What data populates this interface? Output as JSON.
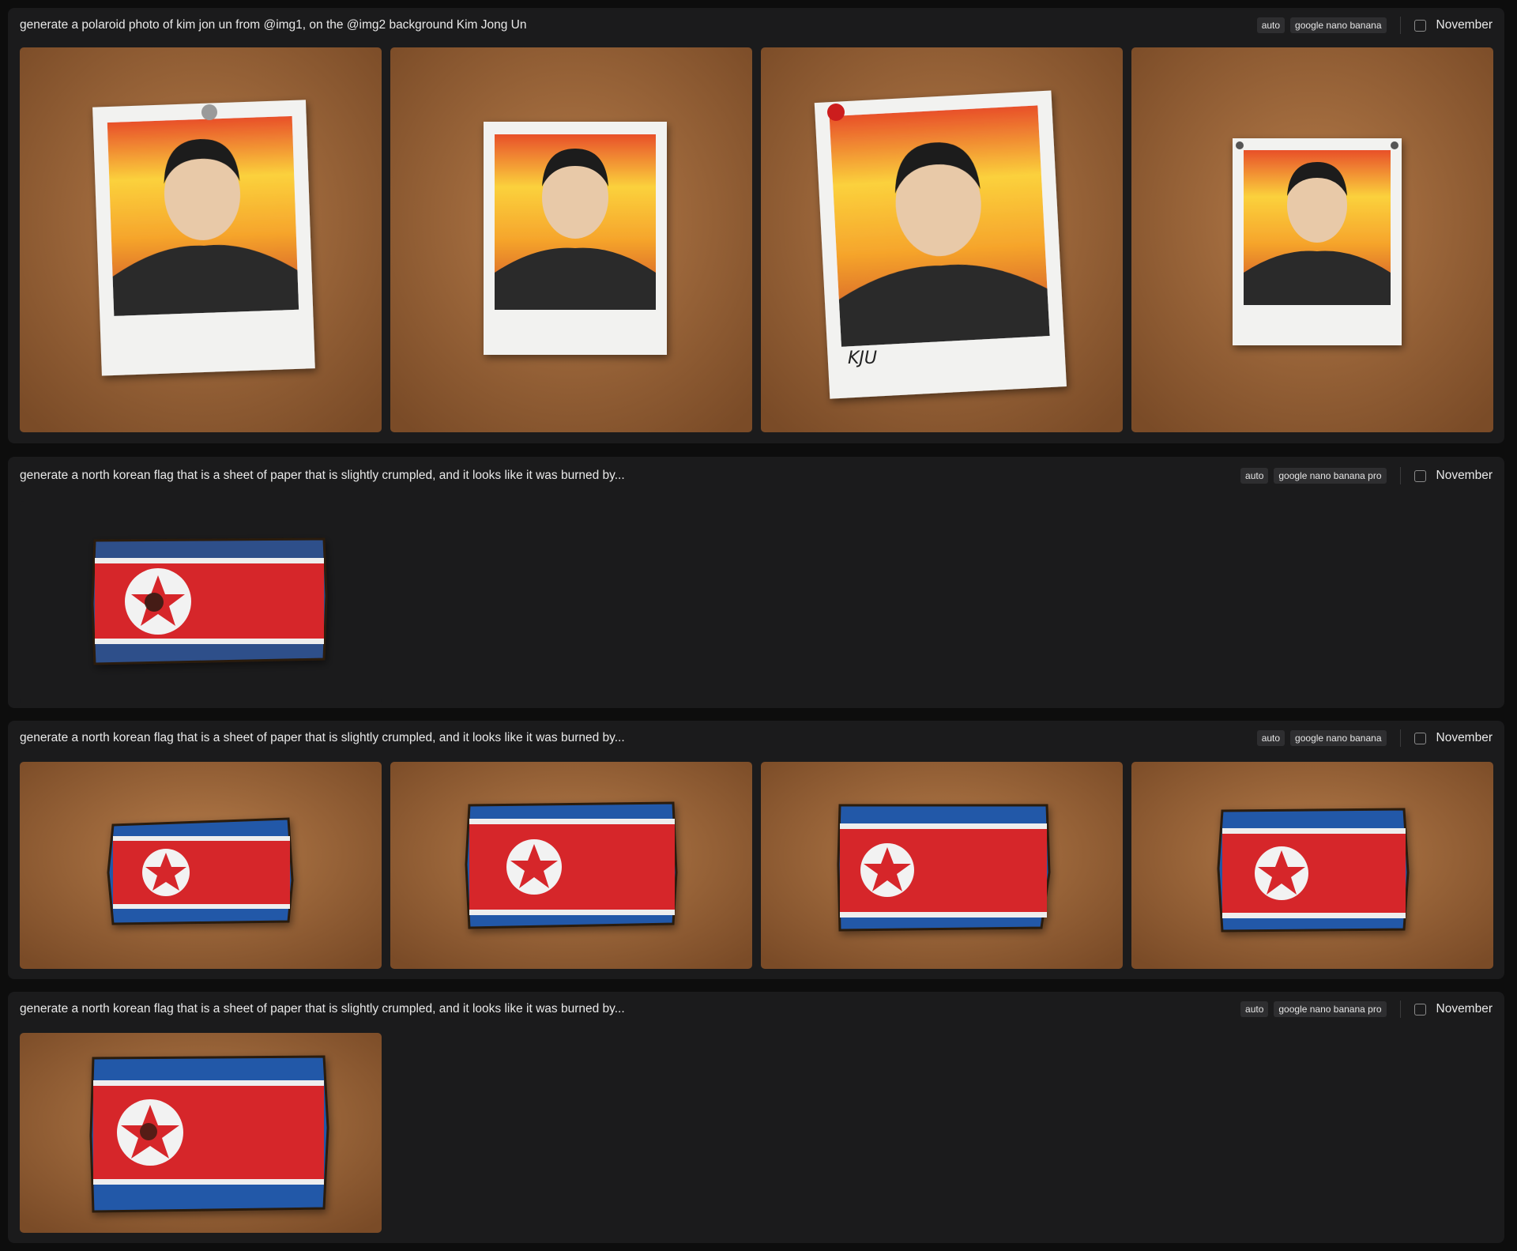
{
  "generations": [
    {
      "prompt": "generate a polaroid photo of kim jon un from @img1, on the @img2 background Kim Jong Un",
      "aspect": "auto",
      "model": "google nano banana",
      "month": "November",
      "images": [
        {
          "type": "polaroid",
          "pin": "silver"
        },
        {
          "type": "polaroid",
          "pin": "none"
        },
        {
          "type": "polaroid",
          "pin": "red",
          "caption": "KJU"
        },
        {
          "type": "polaroid",
          "pin": "corners"
        }
      ]
    },
    {
      "prompt": "generate a north korean flag that is a sheet of paper that is slightly crumpled, and it looks like it was burned by...",
      "aspect": "auto",
      "model": "google nano banana pro",
      "month": "November",
      "images": [
        {
          "type": "flag",
          "background": "dark"
        }
      ]
    },
    {
      "prompt": "generate a north korean flag that is a sheet of paper that is slightly crumpled, and it looks like it was burned by...",
      "aspect": "auto",
      "model": "google nano banana",
      "month": "November",
      "images": [
        {
          "type": "flag",
          "background": "cork"
        },
        {
          "type": "flag",
          "background": "cork"
        },
        {
          "type": "flag",
          "background": "cork"
        },
        {
          "type": "flag",
          "background": "cork"
        }
      ]
    },
    {
      "prompt": "generate a north korean flag that is a sheet of paper that is slightly crumpled, and it looks like it was burned by...",
      "aspect": "auto",
      "model": "google nano banana pro",
      "month": "November",
      "images": [
        {
          "type": "flag",
          "background": "cork"
        }
      ]
    }
  ],
  "colors": {
    "cork": "#a06a3f",
    "flag_red": "#d6262b",
    "flag_blue": "#2458a8",
    "sunset": "#f6b030"
  }
}
